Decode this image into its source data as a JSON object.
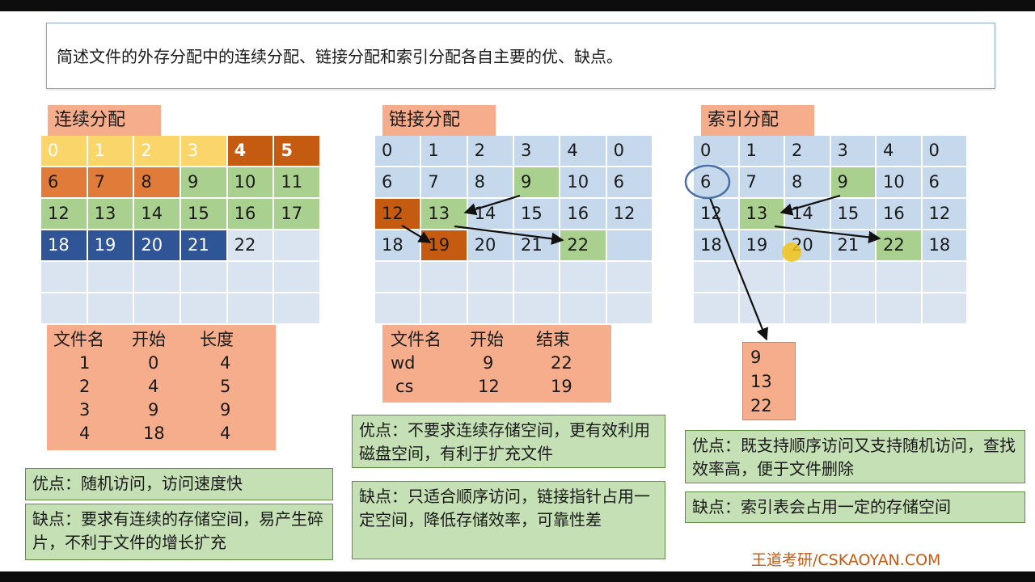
{
  "question": "简述文件的外存分配中的连续分配、链接分配和索引分配各自主要的优、缺点。",
  "contiguous": {
    "title": "连续分配",
    "blocks": [
      "0",
      "1",
      "2",
      "3",
      "4",
      "5",
      "6",
      "7",
      "8",
      "9",
      "10",
      "11",
      "12",
      "13",
      "14",
      "15",
      "16",
      "17",
      "18",
      "19",
      "20",
      "21",
      "22",
      "",
      "",
      "",
      "",
      "",
      "",
      "",
      "",
      "",
      "",
      "",
      "",
      ""
    ],
    "table": {
      "headers": [
        "文件名",
        "开始",
        "长度"
      ],
      "rows": [
        [
          "1",
          "0",
          "4"
        ],
        [
          "2",
          "4",
          "5"
        ],
        [
          "3",
          "9",
          "9"
        ],
        [
          "4",
          "18",
          "4"
        ]
      ]
    },
    "pros": "优点：随机访问，访问速度快",
    "cons": "缺点：要求有连续的存储空间，易产生碎片，不利于文件的增长扩充"
  },
  "linked": {
    "title": "链接分配",
    "blocks": [
      "0",
      "1",
      "2",
      "3",
      "4",
      "0",
      "6",
      "7",
      "8",
      "9",
      "10",
      "6",
      "12",
      "13",
      "14",
      "15",
      "16",
      "12",
      "18",
      "19",
      "20",
      "21",
      "22",
      "",
      "",
      "",
      "",
      "",
      "",
      "",
      "",
      "",
      "",
      "",
      "",
      ""
    ],
    "table": {
      "headers": [
        "文件名",
        "开始",
        "结束"
      ],
      "rows": [
        [
          "wd",
          "9",
          "22"
        ],
        [
          "cs",
          "12",
          "19"
        ]
      ]
    },
    "pros": "优点：不要求连续存储空间，更有效利用磁盘空间，有利于扩充文件",
    "cons": "缺点：只适合顺序访问，链接指针占用一定空间，降低存储效率，可靠性差"
  },
  "indexed": {
    "title": "索引分配",
    "blocks": [
      "0",
      "1",
      "2",
      "3",
      "4",
      "0",
      "6",
      "7",
      "8",
      "9",
      "10",
      "6",
      "12",
      "13",
      "14",
      "15",
      "16",
      "12",
      "18",
      "19",
      "20",
      "21",
      "22",
      "18",
      "",
      "",
      "",
      "",
      "",
      "",
      "",
      "",
      "",
      "",
      "",
      ""
    ],
    "index_block": [
      "9",
      "13",
      "22"
    ],
    "pros": "优点：既支持顺序访问又支持随机访问，查找效率高，便于文件删除",
    "cons": "缺点：索引表会占用一定的存储空间"
  },
  "watermark": "王道考研/CSKAOYAN.COM",
  "colors": {
    "header_fill": "#f6ad8c",
    "block_fill": "#c6d9ec",
    "note_fill": "#c5e0b4",
    "accent": "#c55a11"
  }
}
